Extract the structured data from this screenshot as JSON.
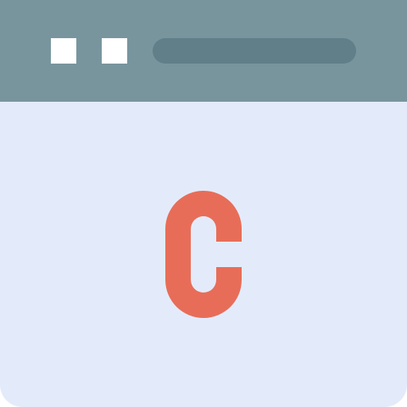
{
  "window": {
    "colors": {
      "titlebar": "#78959E",
      "address_bar": "#617F89",
      "window_buttons": "#FFFFFF",
      "content": "#E3EBFB",
      "icon": "#E86D58"
    }
  },
  "titlebar": {
    "buttons": [
      {
        "icon": "square-button"
      },
      {
        "icon": "square-button"
      }
    ],
    "address_bar": {
      "value": ""
    }
  },
  "content": {
    "icon": "letter-c-icon"
  }
}
